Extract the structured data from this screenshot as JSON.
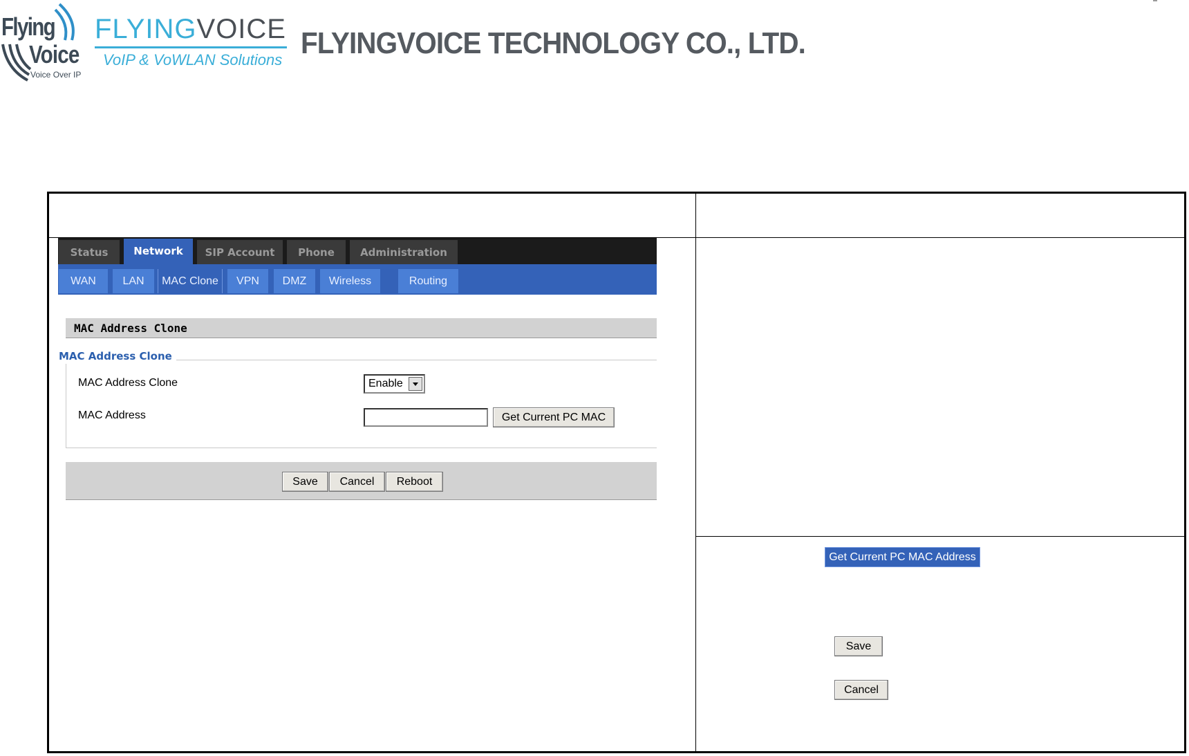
{
  "header": {
    "logo_flying": "Flying",
    "logo_voice": "Voice",
    "logo_voice_over_ip": "Voice Over IP",
    "brand_part1": "FLYING",
    "brand_part2": "VOICE",
    "brand_tagline": "VoIP & VoWLAN Solutions",
    "company_name": "FLYINGVOICE TECHNOLOGY CO., LTD."
  },
  "router_ui": {
    "main_tabs": [
      {
        "label": "Status",
        "active": false
      },
      {
        "label": "Network",
        "active": true
      },
      {
        "label": "SIP Account",
        "active": false
      },
      {
        "label": "Phone",
        "active": false
      },
      {
        "label": "Administration",
        "active": false
      }
    ],
    "sub_tabs": [
      {
        "label": "WAN",
        "active": false
      },
      {
        "label": "LAN",
        "active": false
      },
      {
        "label": "MAC Clone",
        "active": true
      },
      {
        "label": "VPN",
        "active": false
      },
      {
        "label": "DMZ",
        "active": false
      },
      {
        "label": "Wireless",
        "active": false
      },
      {
        "label": "Routing",
        "active": false
      }
    ],
    "section_title": "MAC Address Clone",
    "fieldset_legend": "MAC Address Clone",
    "fields": {
      "clone_label": "MAC Address Clone",
      "clone_value": "Enable",
      "mac_label": "MAC Address",
      "mac_value": "",
      "get_mac_button": "Get Current PC MAC"
    },
    "buttons": {
      "save": "Save",
      "cancel": "Cancel",
      "reboot": "Reboot"
    }
  },
  "right_column": {
    "get_mac_address_button": "Get Current PC MAC Address",
    "save_button": "Save",
    "cancel_button": "Cancel"
  },
  "colors": {
    "nav_blue": "#3462b8",
    "subtab_blue": "#4a7fd6",
    "legend_blue": "#2b5fae",
    "logo_cyan": "#3aaed8"
  }
}
